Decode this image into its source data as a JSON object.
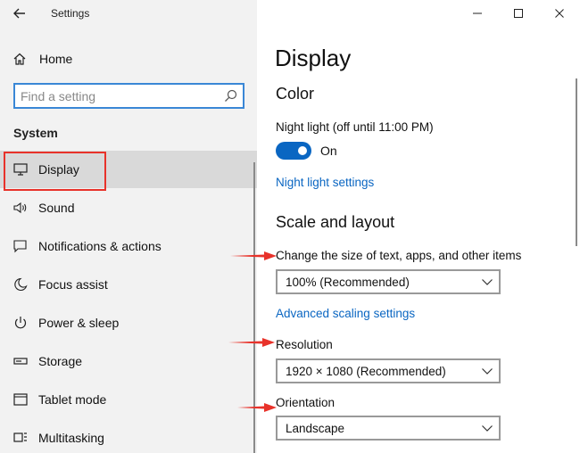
{
  "window": {
    "title": "Settings"
  },
  "sidebar": {
    "home_label": "Home",
    "search_placeholder": "Find a setting",
    "section_heading": "System",
    "items": [
      {
        "label": "Display",
        "icon": "monitor-icon"
      },
      {
        "label": "Sound",
        "icon": "speaker-icon"
      },
      {
        "label": "Notifications & actions",
        "icon": "notification-icon"
      },
      {
        "label": "Focus assist",
        "icon": "moon-icon"
      },
      {
        "label": "Power & sleep",
        "icon": "power-icon"
      },
      {
        "label": "Storage",
        "icon": "storage-icon"
      },
      {
        "label": "Tablet mode",
        "icon": "tablet-icon"
      },
      {
        "label": "Multitasking",
        "icon": "multitask-icon"
      }
    ],
    "selected_index": 0
  },
  "main": {
    "page_title": "Display",
    "color_heading": "Color",
    "night_light_label": "Night light (off until 11:00 PM)",
    "night_light_toggle_state": "On",
    "night_light_settings_link": "Night light settings",
    "scale_heading": "Scale and layout",
    "scale_label": "Change the size of text, apps, and other items",
    "scale_value": "100% (Recommended)",
    "advanced_scaling_link": "Advanced scaling settings",
    "resolution_label": "Resolution",
    "resolution_value": "1920 × 1080 (Recommended)",
    "orientation_label": "Orientation",
    "orientation_value": "Landscape"
  },
  "colors": {
    "accent": "#0a66c2",
    "annotation": "#e8322a",
    "sidebar_bg": "#f2f2f2",
    "selected_bg": "#d9d9d9"
  }
}
